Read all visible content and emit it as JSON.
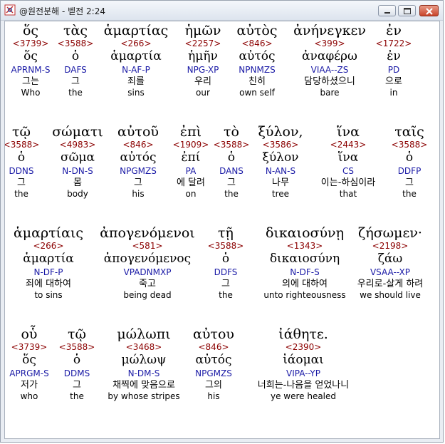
{
  "window": {
    "title": "@원전분해 - 벧전 2:24"
  },
  "rows": [
    {
      "words": [
        {
          "greek": "ὅς",
          "strong": "<3739>",
          "lemma": "ὅς",
          "parse": "APRNM-S",
          "korean": "그는",
          "english": "Who"
        },
        {
          "greek": "τὰς",
          "strong": "<3588>",
          "lemma": "ὁ",
          "parse": "DAFS",
          "korean": "그",
          "english": "the"
        },
        {
          "greek": "ἁμαρτίας",
          "strong": "<266>",
          "lemma": "ἁμαρτία",
          "parse": "N-AF-P",
          "korean": "죄를",
          "english": "sins"
        },
        {
          "greek": "ἡμῶν",
          "strong": "<2257>",
          "lemma": "ἡμῆν",
          "parse": "NPG-XP",
          "korean": "우리",
          "english": "our"
        },
        {
          "greek": "αὐτὸς",
          "strong": "<846>",
          "lemma": "αὐτός",
          "parse": "NPNMZS",
          "korean": "친히",
          "english": "own self"
        },
        {
          "greek": "ἀνήνεγκεν",
          "strong": "<399>",
          "lemma": "ἀναφέρω",
          "parse": "VIAA--ZS",
          "korean": "담당하셨으니",
          "english": "bare"
        },
        {
          "greek": "ἐν",
          "strong": "<1722>",
          "lemma": "ἐν",
          "parse": "PD",
          "korean": "으로",
          "english": "in"
        }
      ]
    },
    {
      "words": [
        {
          "greek": "τῷ",
          "strong": "<3588>",
          "lemma": "ὁ",
          "parse": "DDNS",
          "korean": "그",
          "english": "the"
        },
        {
          "greek": "σώματι",
          "strong": "<4983>",
          "lemma": "σῶμα",
          "parse": "N-DN-S",
          "korean": "몸",
          "english": "body"
        },
        {
          "greek": "αὐτοῦ",
          "strong": "<846>",
          "lemma": "αὐτός",
          "parse": "NPGMZS",
          "korean": "그",
          "english": "his"
        },
        {
          "greek": "ἐπὶ",
          "strong": "<1909>",
          "lemma": "ἐπί",
          "parse": "PA",
          "korean": "에 달려",
          "english": "on"
        },
        {
          "greek": "τὸ",
          "strong": "<3588>",
          "lemma": "ὁ",
          "parse": "DANS",
          "korean": "그",
          "english": "the"
        },
        {
          "greek": "ξύλον,",
          "strong": "<3586>",
          "lemma": "ξύλον",
          "parse": "N-AN-S",
          "korean": "나무",
          "english": "tree"
        },
        {
          "greek": "ἵνα",
          "strong": "<2443>",
          "lemma": "ἵνα",
          "parse": "CS",
          "korean": "이는-하심이라",
          "english": "that"
        },
        {
          "greek": "ταῖς",
          "strong": "<3588>",
          "lemma": "ὁ",
          "parse": "DDFP",
          "korean": "그",
          "english": "the"
        }
      ]
    },
    {
      "words": [
        {
          "greek": "ἁμαρτίαις",
          "strong": "<266>",
          "lemma": "ἁμαρτία",
          "parse": "N-DF-P",
          "korean": "죄에 대하여",
          "english": "to sins"
        },
        {
          "greek": "ἀπογενόμενοι",
          "strong": "<581>",
          "lemma": "ἀπογενόμενος",
          "parse": "VPADNMXP",
          "korean": "죽고",
          "english": "being dead"
        },
        {
          "greek": "τῇ",
          "strong": "<3588>",
          "lemma": "ὁ",
          "parse": "DDFS",
          "korean": "그",
          "english": "the"
        },
        {
          "greek": "δικαιοσύνῃ",
          "strong": "<1343>",
          "lemma": "δικαιοσύνη",
          "parse": "N-DF-S",
          "korean": "의에 대하여",
          "english": "unto righteousness"
        },
        {
          "greek": "ζήσωμεν·",
          "strong": "<2198>",
          "lemma": "ζάω",
          "parse": "VSAA--XP",
          "korean": "우리로-살게 하려",
          "english": "we should live"
        }
      ]
    },
    {
      "words": [
        {
          "greek": "οὗ",
          "strong": "<3739>",
          "lemma": "ὅς",
          "parse": "APRGM-S",
          "korean": "저가",
          "english": "who"
        },
        {
          "greek": "τῷ",
          "strong": "<3588>",
          "lemma": "ὁ",
          "parse": "DDMS",
          "korean": "그",
          "english": "the"
        },
        {
          "greek": "μώλωπι",
          "strong": "<3468>",
          "lemma": "μώλωψ",
          "parse": "N-DM-S",
          "korean": "채찍에 맞음으로",
          "english": "by whose stripes"
        },
        {
          "greek": "αὐτου",
          "strong": "<846>",
          "lemma": "αὐτός",
          "parse": "NPGMZS",
          "korean": "그의",
          "english": "his"
        },
        {
          "greek": "ἰάθητε.",
          "strong": "<2390>",
          "lemma": "ἰάομαι",
          "parse": "VIPA--YP",
          "korean": "너희는-나음을 얻었나니",
          "english": "ye were healed"
        }
      ]
    }
  ]
}
